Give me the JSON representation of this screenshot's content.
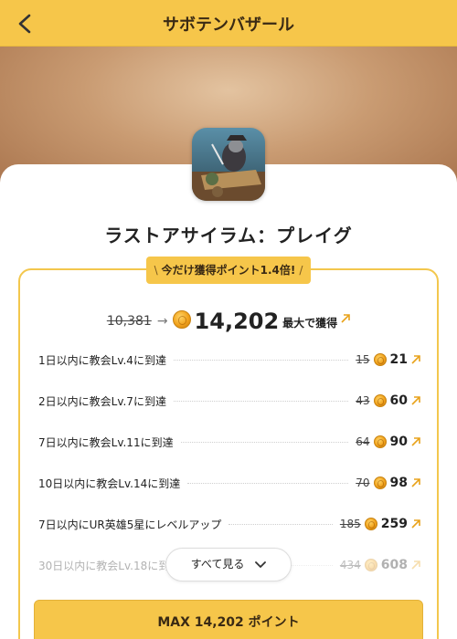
{
  "header": {
    "title": "サボテンバザール"
  },
  "app": {
    "name": "ラストアサイラム：プレイグ"
  },
  "promo": {
    "label": "今だけ獲得ポイント1.4倍!",
    "slash_left": "\\",
    "slash_right": "/"
  },
  "total": {
    "old": "10,381",
    "new": "14,202",
    "label": "最大で獲得"
  },
  "tasks": [
    {
      "label": "1日以内に教会Lv.4に到達",
      "old": "15",
      "new": "21"
    },
    {
      "label": "2日以内に教会Lv.7に到達",
      "old": "43",
      "new": "60"
    },
    {
      "label": "7日以内に教会Lv.11に到達",
      "old": "64",
      "new": "90"
    },
    {
      "label": "10日以内に教会Lv.14に到達",
      "old": "70",
      "new": "98"
    },
    {
      "label": "7日以内にUR英雄5星にレベルアップ",
      "old": "185",
      "new": "259"
    },
    {
      "label": "30日以内に教会Lv.18に到達",
      "old": "434",
      "new": "608"
    }
  ],
  "see_all": {
    "label": "すべて見る"
  },
  "max_button": {
    "label": "MAX 14,202 ポイント"
  },
  "colors": {
    "accent": "#f6c64a",
    "coin": "#f1a21c",
    "link_arrow": "#e8a21a"
  },
  "icons": [
    "chevron-left-icon",
    "coin-icon",
    "external-arrow-icon",
    "chevron-down-icon"
  ]
}
